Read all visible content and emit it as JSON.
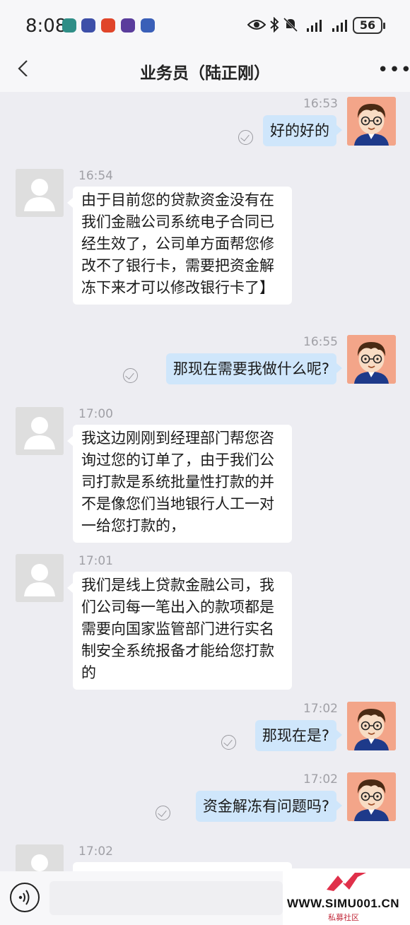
{
  "status_bar": {
    "time": "8:08",
    "battery": "56"
  },
  "header": {
    "title": "业务员（陆正刚）"
  },
  "messages": [
    {
      "time": "16:53",
      "text": "好的好的"
    },
    {
      "time": "16:54",
      "text": "由于目前您的贷款资金没有在我们金融公司系统电子合同已经生效了，公司单方面帮您修改不了银行卡，需要把资金解冻下来才可以修改银行卡了】"
    },
    {
      "time": "16:55",
      "text": "那现在需要我做什么呢?"
    },
    {
      "time": "17:00",
      "text": "我这边刚刚到经理部门帮您咨询过您的订单了，由于我们公司打款是系统批量性打款的并不是像您们当地银行人工一对一给您打款的，"
    },
    {
      "time": "17:01",
      "text": "我们是线上贷款金融公司，我们公司每一笔出入的款项都是需要向国家监管部门进行实名制安全系统报备才能给您打款的"
    },
    {
      "time": "17:02",
      "text": "那现在是?"
    },
    {
      "time": "17:02",
      "text": "资金解冻有问题吗?"
    },
    {
      "time": "17:02",
      "text": ""
    }
  ],
  "watermark": {
    "text": "WWW.SIMU001.CN",
    "sub": "私募社区"
  },
  "colors": {
    "outgoing_bubble": "#cfe6fb",
    "incoming_bubble": "#ffffff",
    "background": "#ededf2",
    "avatar_me_bg": "#f3a589"
  }
}
